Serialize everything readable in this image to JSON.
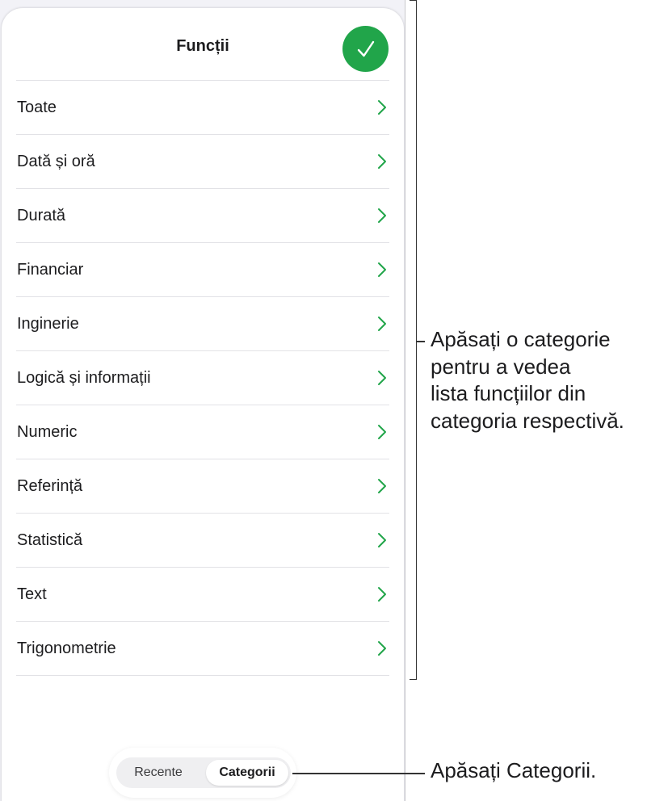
{
  "sheet": {
    "title": "Funcții",
    "done_icon": "checkmark-icon",
    "accent_color": "#21a54a",
    "items": [
      {
        "label": "Toate"
      },
      {
        "label": "Dată și oră"
      },
      {
        "label": "Durată"
      },
      {
        "label": "Financiar"
      },
      {
        "label": "Inginerie"
      },
      {
        "label": "Logică și informații"
      },
      {
        "label": "Numeric"
      },
      {
        "label": "Referință"
      },
      {
        "label": "Statistică"
      },
      {
        "label": "Text"
      },
      {
        "label": "Trigonometrie"
      }
    ],
    "item_icon": "chevron-right-icon"
  },
  "segmented_control": {
    "options": [
      {
        "label": "Recente",
        "selected": false
      },
      {
        "label": "Categorii",
        "selected": true
      }
    ]
  },
  "callouts": {
    "categories_lines": [
      "Apăsați o categorie",
      "pentru a vedea",
      "lista funcțiilor din",
      "categoria respectivă."
    ],
    "tab": "Apăsați Categorii."
  }
}
